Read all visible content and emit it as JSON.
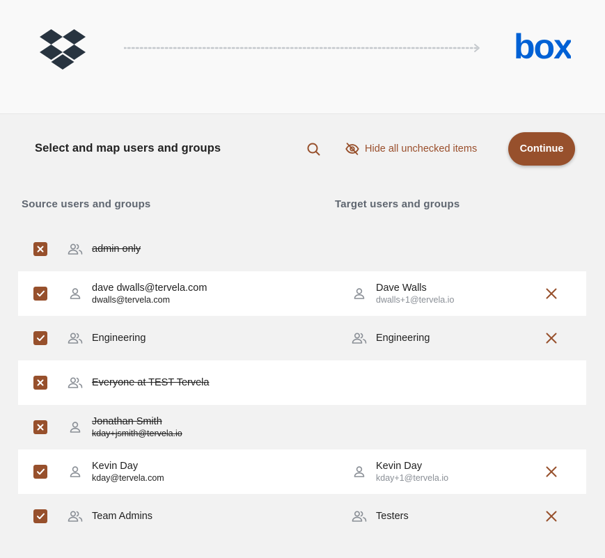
{
  "header": {
    "source_logo": "dropbox-logo",
    "target_logo": "box-logo",
    "target_logo_text": "box",
    "brand_color": "#0061d5"
  },
  "toolbar": {
    "title": "Select and map users and groups",
    "search_icon": "search-icon",
    "hide_label": "Hide all unchecked items",
    "hide_icon": "eye-off-icon",
    "continue_label": "Continue",
    "accent_color": "#97502c"
  },
  "columns": {
    "source_heading": "Source users and groups",
    "target_heading": "Target users and groups"
  },
  "rows": [
    {
      "checked": false,
      "source_type": "group",
      "source_name": "admin only",
      "source_email": "",
      "target_type": "",
      "target_name": "",
      "target_email": ""
    },
    {
      "checked": true,
      "source_type": "user",
      "source_name": "dave dwalls@tervela.com",
      "source_email": "dwalls@tervela.com",
      "target_type": "user",
      "target_name": "Dave Walls",
      "target_email": "dwalls+1@tervela.io"
    },
    {
      "checked": true,
      "source_type": "group",
      "source_name": "Engineering",
      "source_email": "",
      "target_type": "group",
      "target_name": "Engineering",
      "target_email": ""
    },
    {
      "checked": false,
      "source_type": "group",
      "source_name": "Everyone at TEST Tervela",
      "source_email": "",
      "target_type": "",
      "target_name": "",
      "target_email": ""
    },
    {
      "checked": false,
      "source_type": "user",
      "source_name": "Jonathan Smith",
      "source_email": "kday+jsmith@tervela.io",
      "target_type": "",
      "target_name": "",
      "target_email": ""
    },
    {
      "checked": true,
      "source_type": "user",
      "source_name": "Kevin Day",
      "source_email": "kday@tervela.com",
      "target_type": "user",
      "target_name": "Kevin Day",
      "target_email": "kday+1@tervela.io"
    },
    {
      "checked": true,
      "source_type": "group",
      "source_name": "Team Admins",
      "source_email": "",
      "target_type": "group",
      "target_name": "Testers",
      "target_email": ""
    }
  ]
}
